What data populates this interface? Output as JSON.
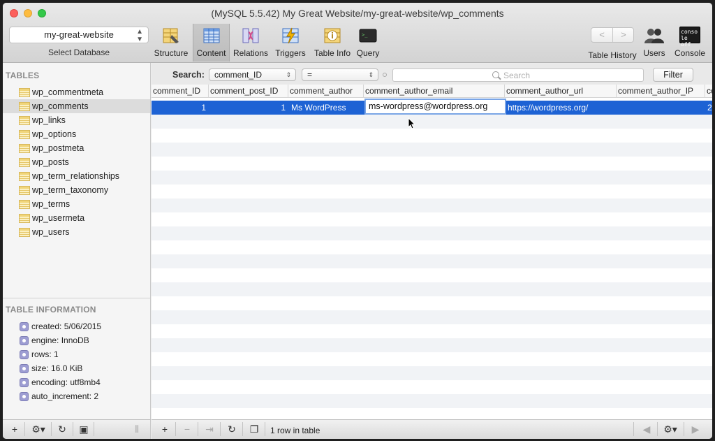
{
  "window": {
    "title": "(MySQL 5.5.42) My Great Website/my-great-website/wp_comments"
  },
  "toolbar": {
    "database_value": "my-great-website",
    "database_label": "Select Database",
    "buttons": [
      {
        "label": "Structure",
        "icon": "structure-icon"
      },
      {
        "label": "Content",
        "icon": "content-icon",
        "active": true
      },
      {
        "label": "Relations",
        "icon": "relations-icon"
      },
      {
        "label": "Triggers",
        "icon": "triggers-icon"
      },
      {
        "label": "Table Info",
        "icon": "table-info-icon"
      },
      {
        "label": "Query",
        "icon": "query-icon"
      }
    ],
    "history_label": "Table History",
    "history_back": "<",
    "history_forward": ">",
    "users_label": "Users",
    "console_label": "Console",
    "console_icon_text_1": "conso",
    "console_icon_text_2": "le off"
  },
  "sidebar": {
    "tables_heading": "TABLES",
    "tables": [
      "wp_commentmeta",
      "wp_comments",
      "wp_links",
      "wp_options",
      "wp_postmeta",
      "wp_posts",
      "wp_term_relationships",
      "wp_term_taxonomy",
      "wp_terms",
      "wp_usermeta",
      "wp_users"
    ],
    "selected_table": "wp_comments",
    "info_heading": "TABLE INFORMATION",
    "info": [
      "created: 5/06/2015",
      "engine: InnoDB",
      "rows: 1",
      "size: 16.0 KiB",
      "encoding: utf8mb4",
      "auto_increment: 2"
    ]
  },
  "filter": {
    "search_label": "Search:",
    "field_value": "comment_ID",
    "operator_value": "=",
    "search_placeholder": "Search",
    "filter_button": "Filter"
  },
  "grid": {
    "columns": [
      "comment_ID",
      "comment_post_ID",
      "comment_author",
      "comment_author_email",
      "comment_author_url",
      "comment_author_IP",
      "co"
    ],
    "row": {
      "comment_ID": "1",
      "comment_post_ID": "1",
      "comment_author": "Ms WordPress",
      "comment_author_email": "ms-wordpress@wordpress.org",
      "comment_author_url": "https://wordpress.org/",
      "comment_author_IP": "",
      "co": "2"
    }
  },
  "bottombar": {
    "status": "1 row in table",
    "add": "+",
    "remove": "−",
    "duplicate": "⇥",
    "refresh": "↻"
  },
  "colors": {
    "selection": "#1d62d4",
    "sidebar_selected": "#dcdcdc"
  }
}
